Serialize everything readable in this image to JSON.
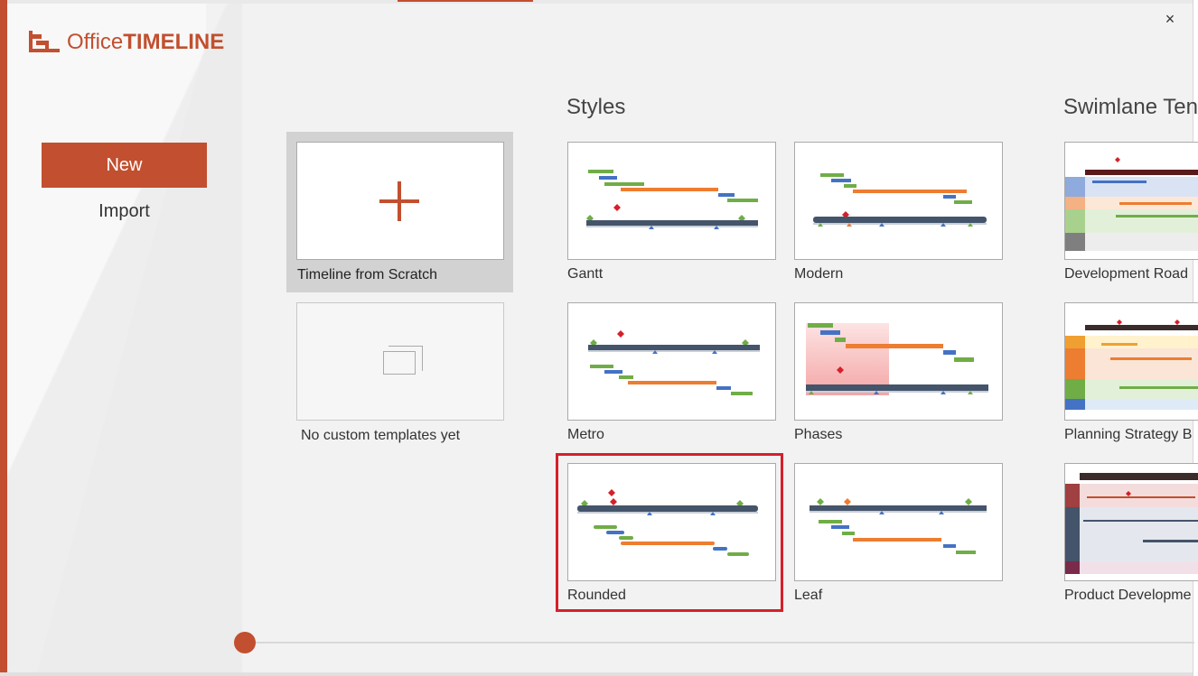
{
  "app": {
    "logo_office": "Office",
    "logo_timeline": "TIMELINE",
    "close_glyph": "×"
  },
  "nav": {
    "new_label": "New",
    "import_label": "Import"
  },
  "sections": {
    "styles_title": "Styles",
    "swimlane_title": "Swimlane Ten"
  },
  "scratch": {
    "label": "Timeline from Scratch",
    "icon": "plus-icon"
  },
  "custom": {
    "label": "No custom templates yet",
    "icon": "copy-icon"
  },
  "styles": [
    {
      "label": "Gantt"
    },
    {
      "label": "Modern"
    },
    {
      "label": "Metro"
    },
    {
      "label": "Phases"
    },
    {
      "label": "Rounded",
      "selected": true
    },
    {
      "label": "Leaf"
    }
  ],
  "swimlanes": [
    {
      "label": "Development Road"
    },
    {
      "label": "Planning Strategy B"
    },
    {
      "label": "Product Developme"
    }
  ],
  "colors": {
    "accent": "#c24f2f",
    "selection": "#d5202a",
    "bar_green": "#70ad47",
    "bar_blue": "#4472c4",
    "bar_orange": "#ed7d31",
    "axis_dark": "#44546a"
  }
}
